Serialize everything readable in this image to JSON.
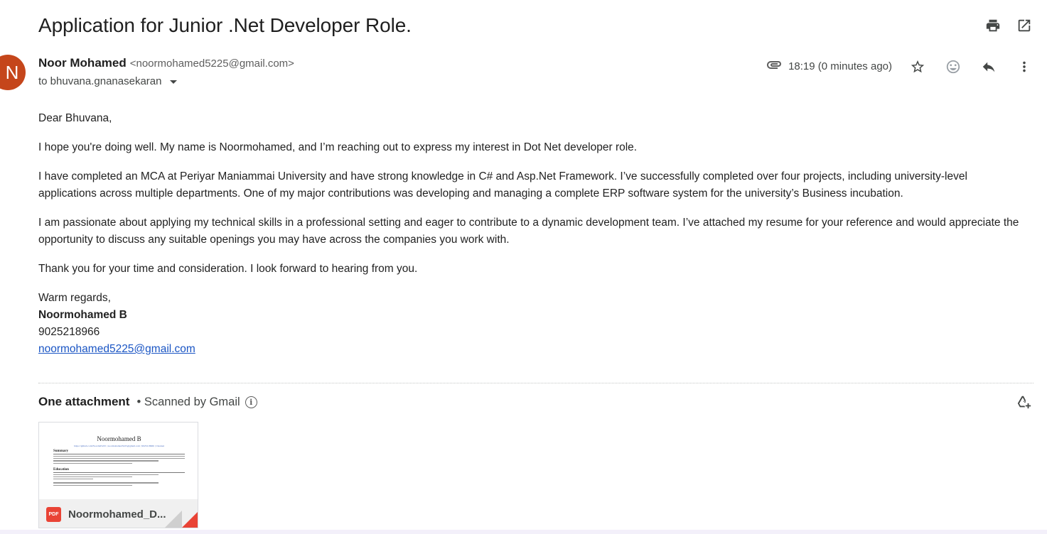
{
  "email": {
    "subject": "Application for Junior .Net Developer Role.",
    "avatar_letter": "N",
    "sender_name": "Noor Mohamed",
    "sender_email": "<noormohamed5225@gmail.com>",
    "to_line": "to bhuvana.gnanasekaran",
    "timestamp": "18:19 (0 minutes ago)"
  },
  "body": {
    "greeting": "Dear Bhuvana,",
    "p1": "I hope you're doing well. My name is Noormohamed, and I’m reaching out to express my interest in Dot Net developer role.",
    "p2": "I have completed an MCA at Periyar Maniammai University and have strong knowledge in C# and Asp.Net Framework. I’ve successfully completed over four projects, including university-level applications across multiple departments. One of my major contributions was developing and managing a complete ERP software system for the university’s Business incubation.",
    "p3": "I am passionate about applying my technical skills in a professional setting and eager to contribute to a dynamic development team. I’ve attached my resume for your reference and would appreciate the opportunity to discuss any suitable openings you may have across the companies you work with.",
    "p4": "Thank you for your time and consideration. I look forward to hearing from you.",
    "closing": "Warm regards,",
    "sig_name": "Noormohamed B",
    "sig_phone": "9025218966",
    "sig_email": "noormohamed5225@gmail.com"
  },
  "attachments": {
    "title": "One attachment",
    "scanned": "• Scanned by Gmail",
    "info_glyph": "i",
    "file": {
      "name": "Noormohamed_D...",
      "type_badge": "PDF",
      "preview_title": "Noormohamed B",
      "preview_links": "https://github.com/Noormd5225  |  noormohamed5225@gmail.com  |  9025218966  |  Chennai",
      "preview_h1": "Summary",
      "preview_h2": "Education"
    }
  },
  "icons": {
    "print": "printer-icon",
    "popout": "open-in-new-window-icon",
    "attachment": "paperclip-icon",
    "star": "star-icon",
    "emoji": "emoji-icon",
    "reply": "reply-icon",
    "more": "more-vert-icon",
    "drive": "add-to-drive-icon"
  },
  "colors": {
    "avatar": "#c5461b",
    "link": "#1a55c4",
    "pdf": "#e94335"
  }
}
